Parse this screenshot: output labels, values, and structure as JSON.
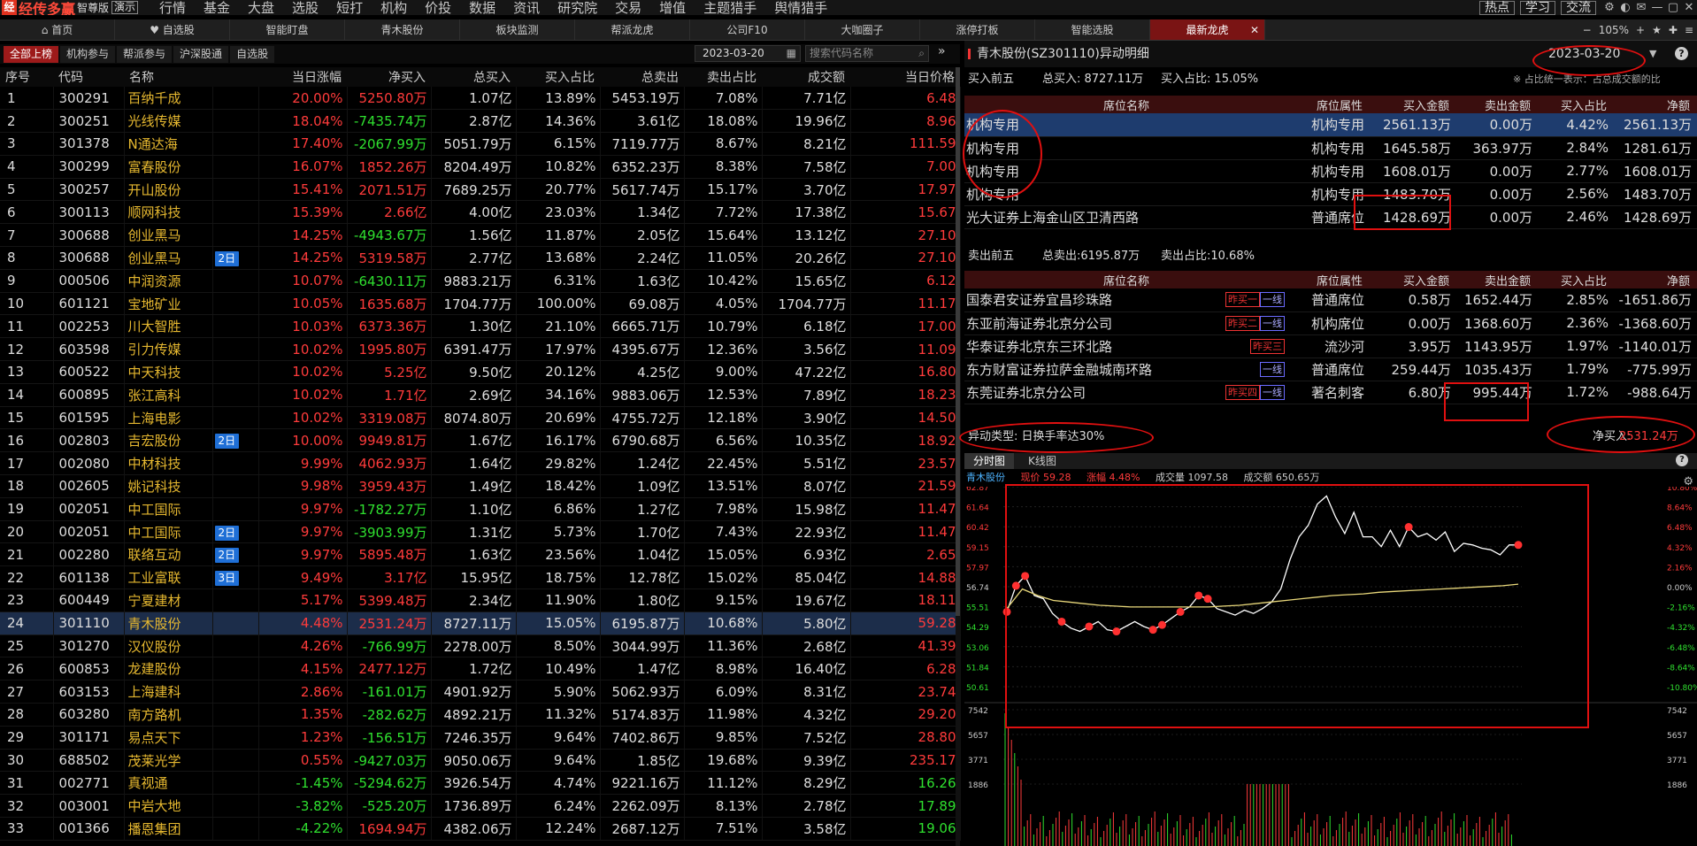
{
  "app": {
    "logo": "经传多赢",
    "edition": "智尊版",
    "demo": "演示"
  },
  "menu": [
    "行情",
    "基金",
    "大盘",
    "选股",
    "短打",
    "机构",
    "价投",
    "数据",
    "资讯",
    "研究院",
    "交易",
    "增值",
    "主题猎手",
    "舆情猎手"
  ],
  "menu_right": {
    "hot": "热点",
    "learn": "学习",
    "exchange": "交流"
  },
  "tabs": [
    {
      "label": "首页",
      "icon": "home-icon"
    },
    {
      "label": "自选股",
      "icon": "heart-icon"
    },
    {
      "label": "智能盯盘"
    },
    {
      "label": "青木股份"
    },
    {
      "label": "板块监测"
    },
    {
      "label": "帮派龙虎"
    },
    {
      "label": "公司F10"
    },
    {
      "label": "大咖圈子"
    },
    {
      "label": "涨停打板"
    },
    {
      "label": "智能选股"
    },
    {
      "label": "最新龙虎",
      "active": true
    }
  ],
  "zoom": "105%",
  "filters": [
    "全部上榜",
    "机构参与",
    "帮派参与",
    "沪深股通",
    "自选股"
  ],
  "date": "2023-03-20",
  "search_placeholder": "搜索代码名称",
  "list": {
    "columns": [
      "序号",
      "代码",
      "名称",
      "",
      "当日涨幅",
      "净买入",
      "总买入",
      "买入占比",
      "总卖出",
      "卖出占比",
      "成交额",
      "当日价格"
    ],
    "rows": [
      {
        "seq": "1",
        "code": "300291",
        "name": "百纳千成",
        "tag": "",
        "pct": "20.00%",
        "net": "5250.80万",
        "tb": "1.07亿",
        "br": "13.89%",
        "ts": "5453.19万",
        "sr": "7.08%",
        "amt": "7.71亿",
        "price": "6.48",
        "dir": "up"
      },
      {
        "seq": "2",
        "code": "300251",
        "name": "光线传媒",
        "tag": "",
        "pct": "18.04%",
        "net": "-7435.74万",
        "tb": "2.87亿",
        "br": "14.36%",
        "ts": "3.61亿",
        "sr": "18.08%",
        "amt": "19.96亿",
        "price": "8.96",
        "dir": "up"
      },
      {
        "seq": "3",
        "code": "301378",
        "name": "N通达海",
        "tag": "",
        "pct": "17.40%",
        "net": "-2067.99万",
        "tb": "5051.79万",
        "br": "6.15%",
        "ts": "7119.77万",
        "sr": "8.67%",
        "amt": "8.21亿",
        "price": "111.59",
        "dir": "up"
      },
      {
        "seq": "4",
        "code": "300299",
        "name": "富春股份",
        "tag": "",
        "pct": "16.07%",
        "net": "1852.26万",
        "tb": "8204.49万",
        "br": "10.82%",
        "ts": "6352.23万",
        "sr": "8.38%",
        "amt": "7.58亿",
        "price": "7.00",
        "dir": "up"
      },
      {
        "seq": "5",
        "code": "300257",
        "name": "开山股份",
        "tag": "",
        "pct": "15.41%",
        "net": "2071.51万",
        "tb": "7689.25万",
        "br": "20.77%",
        "ts": "5617.74万",
        "sr": "15.17%",
        "amt": "3.70亿",
        "price": "17.97",
        "dir": "up"
      },
      {
        "seq": "6",
        "code": "300113",
        "name": "顺网科技",
        "tag": "",
        "pct": "15.39%",
        "net": "2.66亿",
        "tb": "4.00亿",
        "br": "23.03%",
        "ts": "1.34亿",
        "sr": "7.72%",
        "amt": "17.38亿",
        "price": "15.67",
        "dir": "up"
      },
      {
        "seq": "7",
        "code": "300688",
        "name": "创业黑马",
        "tag": "",
        "pct": "14.25%",
        "net": "-4943.67万",
        "tb": "1.56亿",
        "br": "11.87%",
        "ts": "2.05亿",
        "sr": "15.64%",
        "amt": "13.12亿",
        "price": "27.10",
        "dir": "up"
      },
      {
        "seq": "8",
        "code": "300688",
        "name": "创业黑马",
        "tag": "2日",
        "pct": "14.25%",
        "net": "5319.58万",
        "tb": "2.77亿",
        "br": "13.68%",
        "ts": "2.24亿",
        "sr": "11.05%",
        "amt": "20.26亿",
        "price": "27.10",
        "dir": "up"
      },
      {
        "seq": "9",
        "code": "000506",
        "name": "中润资源",
        "tag": "",
        "pct": "10.07%",
        "net": "-6430.11万",
        "tb": "9883.21万",
        "br": "6.31%",
        "ts": "1.63亿",
        "sr": "10.42%",
        "amt": "15.65亿",
        "price": "6.12",
        "dir": "up"
      },
      {
        "seq": "10",
        "code": "601121",
        "name": "宝地矿业",
        "tag": "",
        "pct": "10.05%",
        "net": "1635.68万",
        "tb": "1704.77万",
        "br": "100.00%",
        "ts": "69.08万",
        "sr": "4.05%",
        "amt": "1704.77万",
        "price": "11.17",
        "dir": "up"
      },
      {
        "seq": "11",
        "code": "002253",
        "name": "川大智胜",
        "tag": "",
        "pct": "10.03%",
        "net": "6373.36万",
        "tb": "1.30亿",
        "br": "21.10%",
        "ts": "6665.71万",
        "sr": "10.79%",
        "amt": "6.18亿",
        "price": "17.00",
        "dir": "up"
      },
      {
        "seq": "12",
        "code": "603598",
        "name": "引力传媒",
        "tag": "",
        "pct": "10.02%",
        "net": "1995.80万",
        "tb": "6391.47万",
        "br": "17.97%",
        "ts": "4395.67万",
        "sr": "12.36%",
        "amt": "3.56亿",
        "price": "11.09",
        "dir": "up"
      },
      {
        "seq": "13",
        "code": "600522",
        "name": "中天科技",
        "tag": "",
        "pct": "10.02%",
        "net": "5.25亿",
        "tb": "9.50亿",
        "br": "20.12%",
        "ts": "4.25亿",
        "sr": "9.00%",
        "amt": "47.22亿",
        "price": "16.80",
        "dir": "up"
      },
      {
        "seq": "14",
        "code": "600895",
        "name": "张江高科",
        "tag": "",
        "pct": "10.02%",
        "net": "1.71亿",
        "tb": "2.69亿",
        "br": "34.16%",
        "ts": "9883.06万",
        "sr": "12.53%",
        "amt": "7.89亿",
        "price": "18.23",
        "dir": "up"
      },
      {
        "seq": "15",
        "code": "601595",
        "name": "上海电影",
        "tag": "",
        "pct": "10.02%",
        "net": "3319.08万",
        "tb": "8074.80万",
        "br": "20.69%",
        "ts": "4755.72万",
        "sr": "12.18%",
        "amt": "3.90亿",
        "price": "14.50",
        "dir": "up"
      },
      {
        "seq": "16",
        "code": "002803",
        "name": "吉宏股份",
        "tag": "2日",
        "pct": "10.00%",
        "net": "9949.81万",
        "tb": "1.67亿",
        "br": "16.17%",
        "ts": "6790.68万",
        "sr": "6.56%",
        "amt": "10.35亿",
        "price": "18.92",
        "dir": "up"
      },
      {
        "seq": "17",
        "code": "002080",
        "name": "中材科技",
        "tag": "",
        "pct": "9.99%",
        "net": "4062.93万",
        "tb": "1.64亿",
        "br": "29.82%",
        "ts": "1.24亿",
        "sr": "22.45%",
        "amt": "5.51亿",
        "price": "23.57",
        "dir": "up"
      },
      {
        "seq": "18",
        "code": "002605",
        "name": "姚记科技",
        "tag": "",
        "pct": "9.98%",
        "net": "3959.43万",
        "tb": "1.49亿",
        "br": "18.42%",
        "ts": "1.09亿",
        "sr": "13.51%",
        "amt": "8.07亿",
        "price": "21.59",
        "dir": "up"
      },
      {
        "seq": "19",
        "code": "002051",
        "name": "中工国际",
        "tag": "",
        "pct": "9.97%",
        "net": "-1782.27万",
        "tb": "1.10亿",
        "br": "6.86%",
        "ts": "1.27亿",
        "sr": "7.98%",
        "amt": "15.98亿",
        "price": "11.47",
        "dir": "up"
      },
      {
        "seq": "20",
        "code": "002051",
        "name": "中工国际",
        "tag": "2日",
        "pct": "9.97%",
        "net": "-3903.99万",
        "tb": "1.31亿",
        "br": "5.73%",
        "ts": "1.70亿",
        "sr": "7.43%",
        "amt": "22.93亿",
        "price": "11.47",
        "dir": "up"
      },
      {
        "seq": "21",
        "code": "002280",
        "name": "联络互动",
        "tag": "2日",
        "pct": "9.97%",
        "net": "5895.48万",
        "tb": "1.63亿",
        "br": "23.56%",
        "ts": "1.04亿",
        "sr": "15.05%",
        "amt": "6.93亿",
        "price": "2.65",
        "dir": "up"
      },
      {
        "seq": "22",
        "code": "601138",
        "name": "工业富联",
        "tag": "3日",
        "pct": "9.49%",
        "net": "3.17亿",
        "tb": "15.95亿",
        "br": "18.75%",
        "ts": "12.78亿",
        "sr": "15.02%",
        "amt": "85.04亿",
        "price": "14.88",
        "dir": "up"
      },
      {
        "seq": "23",
        "code": "600449",
        "name": "宁夏建材",
        "tag": "",
        "pct": "5.17%",
        "net": "5399.48万",
        "tb": "2.34亿",
        "br": "11.90%",
        "ts": "1.80亿",
        "sr": "9.15%",
        "amt": "19.67亿",
        "price": "18.11",
        "dir": "up"
      },
      {
        "seq": "24",
        "code": "301110",
        "name": "青木股份",
        "tag": "",
        "pct": "4.48%",
        "net": "2531.24万",
        "tb": "8727.11万",
        "br": "15.05%",
        "ts": "6195.87万",
        "sr": "10.68%",
        "amt": "5.80亿",
        "price": "59.28",
        "dir": "up",
        "selected": true
      },
      {
        "seq": "25",
        "code": "301270",
        "name": "汉仪股份",
        "tag": "",
        "pct": "4.26%",
        "net": "-766.99万",
        "tb": "2278.00万",
        "br": "8.50%",
        "ts": "3044.99万",
        "sr": "11.36%",
        "amt": "2.68亿",
        "price": "41.39",
        "dir": "up"
      },
      {
        "seq": "26",
        "code": "600853",
        "name": "龙建股份",
        "tag": "",
        "pct": "4.15%",
        "net": "2477.12万",
        "tb": "1.72亿",
        "br": "10.49%",
        "ts": "1.47亿",
        "sr": "8.98%",
        "amt": "16.40亿",
        "price": "6.28",
        "dir": "up"
      },
      {
        "seq": "27",
        "code": "603153",
        "name": "上海建科",
        "tag": "",
        "pct": "2.86%",
        "net": "-161.01万",
        "tb": "4901.92万",
        "br": "5.90%",
        "ts": "5062.93万",
        "sr": "6.09%",
        "amt": "8.31亿",
        "price": "23.74",
        "dir": "up"
      },
      {
        "seq": "28",
        "code": "603280",
        "name": "南方路机",
        "tag": "",
        "pct": "1.35%",
        "net": "-282.62万",
        "tb": "4892.21万",
        "br": "11.32%",
        "ts": "5174.83万",
        "sr": "11.98%",
        "amt": "4.32亿",
        "price": "29.20",
        "dir": "up"
      },
      {
        "seq": "29",
        "code": "301171",
        "name": "易点天下",
        "tag": "",
        "pct": "1.23%",
        "net": "-156.51万",
        "tb": "7246.35万",
        "br": "9.64%",
        "ts": "7402.86万",
        "sr": "9.85%",
        "amt": "7.52亿",
        "price": "28.80",
        "dir": "up"
      },
      {
        "seq": "30",
        "code": "688502",
        "name": "茂莱光学",
        "tag": "",
        "pct": "0.55%",
        "net": "-9427.03万",
        "tb": "9050.06万",
        "br": "9.64%",
        "ts": "1.85亿",
        "sr": "19.68%",
        "amt": "9.39亿",
        "price": "235.17",
        "dir": "up"
      },
      {
        "seq": "31",
        "code": "002771",
        "name": "真视通",
        "tag": "",
        "pct": "-1.45%",
        "net": "-5294.62万",
        "tb": "3926.54万",
        "br": "4.74%",
        "ts": "9221.16万",
        "sr": "11.12%",
        "amt": "8.29亿",
        "price": "16.26",
        "dir": "dn"
      },
      {
        "seq": "32",
        "code": "003001",
        "name": "中岩大地",
        "tag": "",
        "pct": "-3.82%",
        "net": "-525.20万",
        "tb": "1736.89万",
        "br": "6.24%",
        "ts": "2262.09万",
        "sr": "8.13%",
        "amt": "2.78亿",
        "price": "17.89",
        "dir": "dn"
      },
      {
        "seq": "33",
        "code": "001366",
        "name": "播恩集团",
        "tag": "",
        "pct": "-4.22%",
        "net": "1694.94万",
        "tb": "4382.06万",
        "br": "12.24%",
        "ts": "2687.12万",
        "sr": "7.51%",
        "amt": "3.58亿",
        "price": "19.06",
        "dir": "dn"
      }
    ]
  },
  "detail": {
    "title": "青木股份(SZ301110)异动明细",
    "date": "2023-03-20",
    "buy_head": {
      "label": "买入前五",
      "total": "总买入: 8727.11万",
      "ratio": "买入占比: 15.05%",
      "note": "※ 占比统一表示：占总成交额的比"
    },
    "sell_head": {
      "label": "卖出前五",
      "total": "总卖出:6195.87万",
      "ratio": "卖出占比:10.68%"
    },
    "columns": [
      "席位名称",
      "席位属性",
      "买入金额",
      "卖出金额",
      "买入占比",
      "净额"
    ],
    "buy_rows": [
      {
        "name": "机构专用",
        "attr": "机构专用",
        "buy": "2561.13万",
        "sell": "0.00万",
        "ratio": "4.42%",
        "net": "2561.13万",
        "selected": true
      },
      {
        "name": "机构专用",
        "attr": "机构专用",
        "buy": "1645.58万",
        "sell": "363.97万",
        "ratio": "2.84%",
        "net": "1281.61万"
      },
      {
        "name": "机构专用",
        "attr": "机构专用",
        "buy": "1608.01万",
        "sell": "0.00万",
        "ratio": "2.77%",
        "net": "1608.01万"
      },
      {
        "name": "机构专用",
        "attr": "机构专用",
        "buy": "1483.70万",
        "sell": "0.00万",
        "ratio": "2.56%",
        "net": "1483.70万"
      },
      {
        "name": "光大证券上海金山区卫清西路",
        "attr": "普通席位",
        "buy": "1428.69万",
        "sell": "0.00万",
        "ratio": "2.46%",
        "net": "1428.69万"
      }
    ],
    "sell_rows": [
      {
        "name": "国泰君安证券宜昌珍珠路",
        "tags": [
          "昨买一",
          "一线"
        ],
        "attr": "普通席位",
        "buy": "0.58万",
        "sell": "1652.44万",
        "ratio": "2.85%",
        "net": "-1651.86万"
      },
      {
        "name": "东亚前海证券北京分公司",
        "tags": [
          "昨买二",
          "一线"
        ],
        "attr": "机构席位",
        "buy": "0.00万",
        "sell": "1368.60万",
        "ratio": "2.36%",
        "net": "-1368.60万"
      },
      {
        "name": "华泰证券北京东三环北路",
        "tags": [
          "昨买三"
        ],
        "attr": "流沙河",
        "buy": "3.95万",
        "sell": "1143.95万",
        "ratio": "1.97%",
        "net": "-1140.01万"
      },
      {
        "name": "东方财富证券拉萨金融城南环路",
        "tags": [
          "一线"
        ],
        "attr": "普通席位",
        "buy": "259.44万",
        "sell": "1035.43万",
        "ratio": "1.79%",
        "net": "-775.99万"
      },
      {
        "name": "东莞证券北京分公司",
        "tags": [
          "昨买四",
          "一线"
        ],
        "attr": "著名刺客",
        "buy": "6.80万",
        "sell": "995.44万",
        "ratio": "1.72%",
        "net": "-988.64万"
      }
    ],
    "anomaly": "异动类型: 日换手率达30%",
    "net_buy_label": "净买入:",
    "net_buy": "2531.24万"
  },
  "chart_tabs": [
    "分时图",
    "K线图"
  ],
  "chart_info": {
    "name": "青木股份",
    "price": "现价 59.28",
    "change": "涨幅 4.48%",
    "volume": "成交量 1097.58",
    "turnover": "成交额 650.65万"
  },
  "chart_data": {
    "type": "line",
    "ylim": [
      50.61,
      62.87
    ],
    "price_ticks": [
      "62.87",
      "61.64",
      "60.42",
      "59.15",
      "57.97",
      "56.74",
      "55.51",
      "54.29",
      "53.06",
      "51.84",
      "50.61"
    ],
    "pct_ticks": [
      "10.80%",
      "8.64%",
      "6.48%",
      "4.32%",
      "2.16%",
      "0.00%",
      "-2.16%",
      "-4.32%",
      "-6.48%",
      "-8.64%",
      "-10.80%"
    ],
    "vol_ticks": [
      "7542",
      "5657",
      "3771",
      "1886"
    ],
    "series": [
      {
        "values": [
          55.2,
          56.8,
          57.4,
          56.2,
          56.0,
          55.1,
          54.6,
          54.2,
          54.0,
          54.3,
          54.6,
          54.1,
          54.0,
          54.3,
          54.6,
          54.3,
          54.1,
          54.4,
          54.8,
          55.2,
          55.5,
          56.2,
          56.0,
          55.4,
          55.2,
          55.0,
          55.3,
          55.1,
          55.4,
          55.8,
          56.6,
          58.4,
          59.8,
          60.5,
          61.8,
          62.3,
          61.0,
          60.0,
          61.3,
          59.8,
          59.8,
          59.2,
          60.2,
          59.2,
          60.4,
          59.8,
          60.0,
          59.6,
          60.1,
          58.9,
          59.4,
          59.3,
          59.1,
          59.0,
          58.7,
          59.3,
          59.3
        ]
      },
      {
        "values": [
          55.4,
          56.6,
          56.2,
          55.9,
          55.8,
          55.7,
          55.6,
          55.55,
          55.5,
          55.5,
          55.5,
          55.5,
          55.5,
          55.5,
          55.55,
          55.6,
          55.7,
          55.8,
          55.9,
          56.0,
          56.1,
          56.2,
          56.25,
          56.3,
          56.4,
          56.45,
          56.5,
          56.55,
          56.6,
          56.65,
          56.7,
          56.75,
          56.8,
          56.9
        ]
      }
    ]
  }
}
